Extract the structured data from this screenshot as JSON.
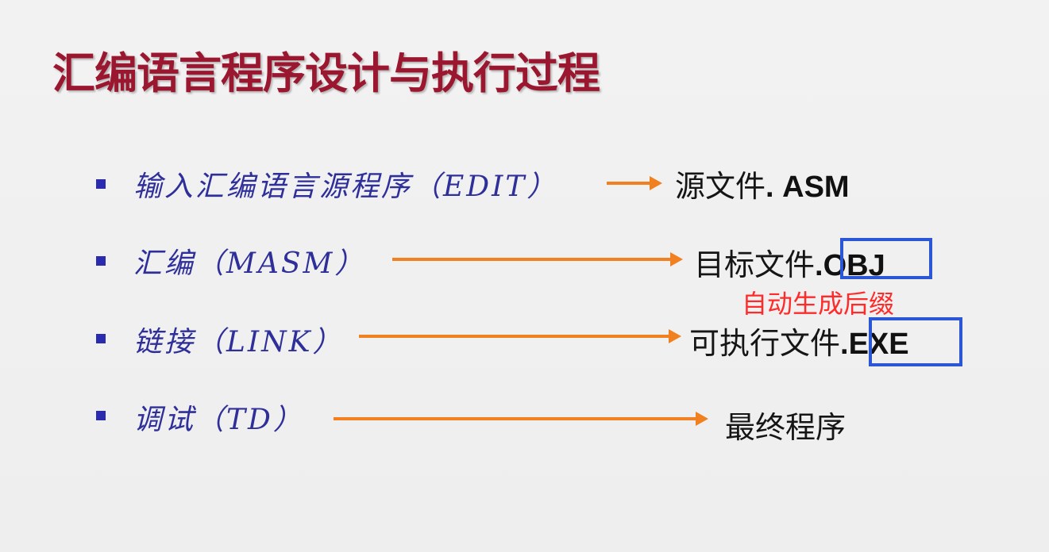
{
  "slide": {
    "title": "汇编语言程序设计与执行过程",
    "rows": [
      {
        "label": "输入汇编语言源程序（EDIT）",
        "result_text": "源文件",
        "result_ext": ". ASM"
      },
      {
        "label": "汇编（MASM）",
        "result_text": "目标文件",
        "result_ext": ".OBJ"
      },
      {
        "label": "链接（LINK）",
        "result_text": "可执行文件",
        "result_ext": ".EXE"
      },
      {
        "label": "调试（TD）",
        "result_text": "最终程序",
        "result_ext": ""
      }
    ],
    "annotation": "自动生成后缀"
  },
  "colors": {
    "title": "#9b1730",
    "bullet": "#2b2bb0",
    "label": "#2f2f9a",
    "arrow": "#f08020",
    "highlight_box": "#2b57d6",
    "annotation": "#ff2a2a"
  },
  "icons": {
    "bullet": "square-bullet-icon",
    "arrow": "arrow-right-icon"
  }
}
